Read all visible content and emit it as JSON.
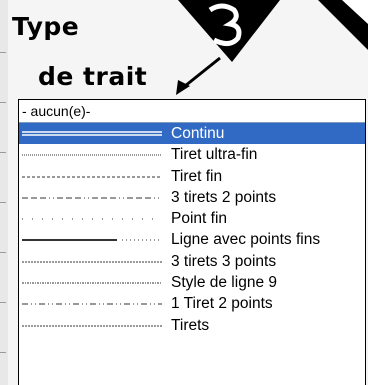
{
  "heading": {
    "line1": "Type",
    "line2": "de trait"
  },
  "dropdown": {
    "selected_value": "- aucun(e)-",
    "items": [
      {
        "label": "Continu",
        "style": "solid-double",
        "selected": true
      },
      {
        "label": "Tiret ultra-fin",
        "style": "ultra-fine-dash",
        "selected": false
      },
      {
        "label": "Tiret fin",
        "style": "fine-dash",
        "selected": false
      },
      {
        "label": "3 tirets 2 points",
        "style": "dash3-dot2",
        "selected": false
      },
      {
        "label": "Point fin",
        "style": "fine-dot",
        "selected": false
      },
      {
        "label": "Ligne avec points fins",
        "style": "line-dots",
        "selected": false
      },
      {
        "label": "3 tirets 3 points",
        "style": "dash3-dot3",
        "selected": false
      },
      {
        "label": "Style de ligne 9",
        "style": "style9",
        "selected": false
      },
      {
        "label": "1 Tiret 2 points",
        "style": "dash1-dot2",
        "selected": false
      },
      {
        "label": "Tirets",
        "style": "dashes",
        "selected": false
      }
    ]
  },
  "colors": {
    "selection": "#316ac5",
    "selection_text": "#ffffff",
    "border": "#000000"
  }
}
